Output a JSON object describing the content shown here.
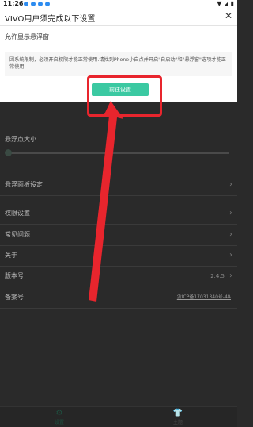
{
  "status_bar": {
    "time": "11:26",
    "icons": [
      "wifi-icon",
      "signal-icon",
      "battery-icon"
    ]
  },
  "dialog": {
    "title": "VIVO用户须完成以下设置",
    "subtitle": "允许显示悬浮窗",
    "message": "因系统限制，必须开启权限才能正常使用.请找到Phone小白点并开启\"自启动\"和\"悬浮窗\"选项才能正常使用",
    "primary_button": "前往设置",
    "close_icon": "close-icon"
  },
  "settings": {
    "slider_label": "悬浮点大小",
    "items": [
      {
        "label": "悬浮面板设定"
      },
      {
        "label": "权限设置"
      },
      {
        "label": "常见问题"
      },
      {
        "label": "关于"
      },
      {
        "label": "版本号",
        "value": "2.4.5"
      },
      {
        "label": "备案号",
        "value": "浙ICP备17031340号-4A"
      }
    ]
  },
  "bottom_nav": {
    "tabs": [
      {
        "label": "设置",
        "icon": "gear-icon",
        "active": true
      },
      {
        "label": "主题",
        "icon": "shirt-icon",
        "active": false
      }
    ]
  },
  "colors": {
    "accent": "#3bc9a2",
    "highlight": "#e8252d",
    "dark_bg": "#2a2a2a"
  }
}
